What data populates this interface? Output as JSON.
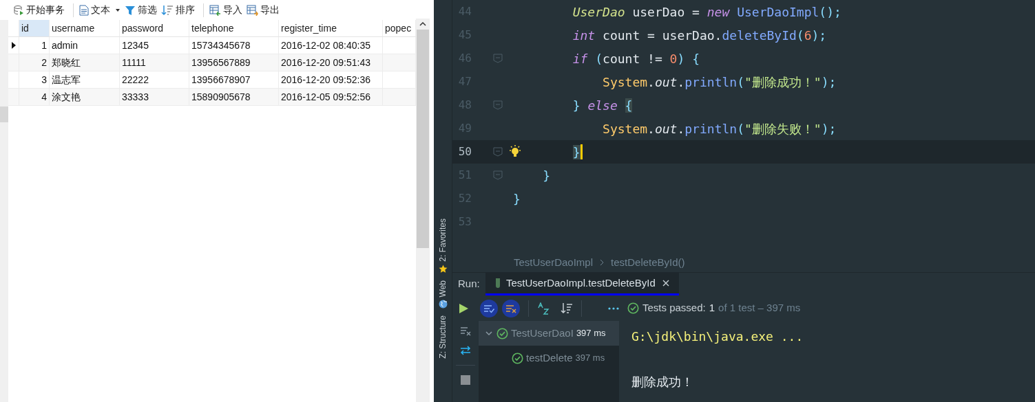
{
  "db_toolbar": [
    {
      "kind": "transaction",
      "label": "开始事务"
    },
    {
      "kind": "text",
      "label": "文本",
      "dropdown": true
    },
    {
      "kind": "filter",
      "label": "筛选"
    },
    {
      "kind": "sort",
      "label": "排序"
    },
    {
      "kind": "import",
      "label": "导入"
    },
    {
      "kind": "export",
      "label": "导出"
    }
  ],
  "table": {
    "columns": [
      {
        "label": "id",
        "selected": true
      },
      {
        "label": "username",
        "selected": false
      },
      {
        "label": "password",
        "selected": false
      },
      {
        "label": "telephone",
        "selected": false
      },
      {
        "label": "register_time",
        "selected": false
      },
      {
        "label": "popec",
        "selected": false
      }
    ],
    "rows": [
      {
        "selected": true,
        "cells": [
          "1",
          "admin",
          "12345",
          "15734345678",
          "2016-12-02 08:40:35",
          ""
        ]
      },
      {
        "selected": false,
        "cells": [
          "2",
          "郑晓红",
          "11111",
          "13956567889",
          "2016-12-20 09:51:43",
          ""
        ]
      },
      {
        "selected": false,
        "cells": [
          "3",
          "温志军",
          "22222",
          "13956678907",
          "2016-12-20 09:52:36",
          ""
        ]
      },
      {
        "selected": false,
        "cells": [
          "4",
          "涂文艳",
          "33333",
          "15890905678",
          "2016-12-05 09:52:56",
          ""
        ]
      }
    ]
  },
  "side_tools": [
    {
      "kind": "favorites",
      "label": "2: Favorites"
    },
    {
      "kind": "web",
      "label": "Web"
    },
    {
      "kind": "structure",
      "label": "Z: Structure"
    }
  ],
  "editor": {
    "lines": [
      {
        "number": "44",
        "current": false,
        "fold": false,
        "tokens": [
          {
            "kind": "type",
            "text": "        UserDao"
          },
          {
            "kind": "plain",
            "text": " userDao = "
          },
          {
            "kind": "keyword",
            "text": "new"
          },
          {
            "kind": "method",
            "text": " UserDaoImpl"
          },
          {
            "kind": "punct",
            "text": "();"
          }
        ]
      },
      {
        "number": "45",
        "current": false,
        "fold": false,
        "tokens": [
          {
            "kind": "keyword",
            "text": "        int"
          },
          {
            "kind": "plain",
            "text": " count = userDao."
          },
          {
            "kind": "method",
            "text": "deleteById"
          },
          {
            "kind": "punct",
            "text": "("
          },
          {
            "kind": "number",
            "text": "6"
          },
          {
            "kind": "punct",
            "text": ");"
          }
        ]
      },
      {
        "number": "46",
        "current": false,
        "fold": true,
        "tokens": [
          {
            "kind": "keyword",
            "text": "        if"
          },
          {
            "kind": "punct",
            "text": " ("
          },
          {
            "kind": "plain",
            "text": "count != "
          },
          {
            "kind": "number",
            "text": "0"
          },
          {
            "kind": "punct",
            "text": ") {"
          }
        ]
      },
      {
        "number": "47",
        "current": false,
        "fold": false,
        "tokens": [
          {
            "kind": "field",
            "text": "            System"
          },
          {
            "kind": "plain",
            "text": "."
          },
          {
            "kind": "static",
            "text": "out"
          },
          {
            "kind": "plain",
            "text": "."
          },
          {
            "kind": "method",
            "text": "println"
          },
          {
            "kind": "punct",
            "text": "("
          },
          {
            "kind": "string",
            "text": "\"删除成功！\""
          },
          {
            "kind": "punct",
            "text": ");"
          }
        ]
      },
      {
        "number": "48",
        "current": false,
        "fold": true,
        "tokens": [
          {
            "kind": "punct",
            "text": "        } "
          },
          {
            "kind": "keyword",
            "text": "else"
          },
          {
            "kind": "brace",
            "text": " {"
          }
        ]
      },
      {
        "number": "49",
        "current": false,
        "fold": false,
        "tokens": [
          {
            "kind": "field",
            "text": "            System"
          },
          {
            "kind": "plain",
            "text": "."
          },
          {
            "kind": "static",
            "text": "out"
          },
          {
            "kind": "plain",
            "text": "."
          },
          {
            "kind": "method",
            "text": "println"
          },
          {
            "kind": "punct",
            "text": "("
          },
          {
            "kind": "string",
            "text": "\"删除失败！\""
          },
          {
            "kind": "punct",
            "text": ");"
          }
        ]
      },
      {
        "number": "50",
        "current": true,
        "fold": true,
        "tokens": [
          {
            "kind": "brace",
            "text": "        }"
          }
        ]
      },
      {
        "number": "51",
        "current": false,
        "fold": true,
        "tokens": [
          {
            "kind": "punct",
            "text": "    }"
          }
        ]
      },
      {
        "number": "52",
        "current": false,
        "fold": false,
        "tokens": [
          {
            "kind": "punct",
            "text": "}"
          }
        ]
      },
      {
        "number": "53",
        "current": false,
        "fold": false
      }
    ]
  },
  "breadcrumb": [
    "TestUserDaoImpl",
    "testDeleteById()"
  ],
  "run": {
    "label": "Run:",
    "tab": "TestUserDaoImpl.testDeleteById",
    "status": {
      "label": "Tests passed:",
      "count": "1",
      "detail": "of 1 test – 397 ms"
    },
    "tree": [
      {
        "label": "TestUserDaoI",
        "time": "397 ms",
        "expanded": true,
        "selected": true,
        "children": [
          {
            "label": "testDelete",
            "time": "397 ms",
            "selected": false
          }
        ]
      }
    ],
    "console": [
      {
        "kind": "command",
        "text": "G:\\jdk\\bin\\java.exe ..."
      },
      {
        "kind": "blank"
      },
      {
        "kind": "output",
        "text": "删除成功！"
      }
    ]
  }
}
